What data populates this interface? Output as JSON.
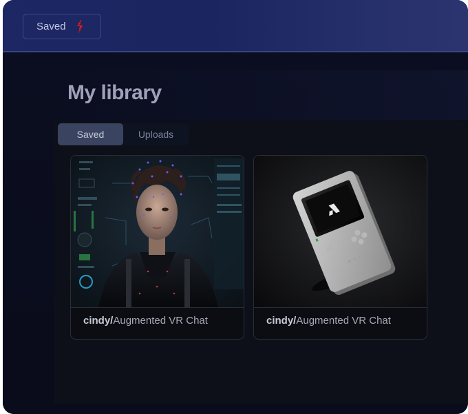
{
  "header": {
    "saved_button_label": "Saved",
    "bolt_icon_color": "#e0202a"
  },
  "page": {
    "title": "My library"
  },
  "tabs": [
    {
      "label": "Saved",
      "active": true
    },
    {
      "label": "Uploads",
      "active": false
    }
  ],
  "cards": [
    {
      "user": "cindy/",
      "name": "Augmented VR Chat",
      "image": "vr-woman-portrait-image"
    },
    {
      "user": "cindy/",
      "name": "Augmented VR Chat",
      "image": "handheld-console-image"
    }
  ],
  "colors": {
    "background": "#080b1a",
    "topbar": "#1c2763",
    "active_tab": "#3a4460"
  }
}
